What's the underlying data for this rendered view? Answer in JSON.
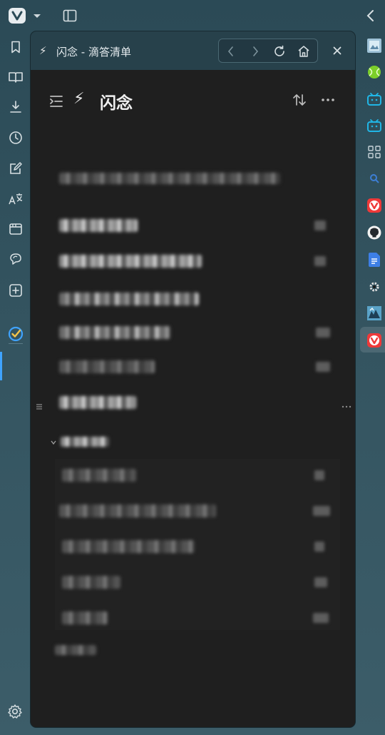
{
  "panel": {
    "title_icon": "⚡",
    "title": "闪念 - 滴答清单"
  },
  "list": {
    "icon": "⚡",
    "name": "闪念"
  },
  "icons": {
    "vivaldi_logo": "vivaldi-icon",
    "sidebar": [
      "bookmark-icon",
      "reading-list-icon",
      "download-icon",
      "history-icon",
      "notes-icon",
      "translate-icon",
      "window-icon",
      "feed-icon",
      "add-panel-icon",
      "ticktick-icon",
      "settings-icon"
    ],
    "web_panels": [
      "picture-icon",
      "tennis-ball-icon",
      "bilibili-icon",
      "bilibili-icon",
      "apps-grid-icon",
      "search-icon",
      "vivaldi-icon",
      "github-icon",
      "docs-icon",
      "gear-icon",
      "image-icon",
      "vivaldi-icon"
    ]
  },
  "colors": {
    "accent": "#3fa3ff",
    "panel_bg": "#1f1f1f",
    "header_bg": "#27414b",
    "frame_bg": "#33535f"
  }
}
